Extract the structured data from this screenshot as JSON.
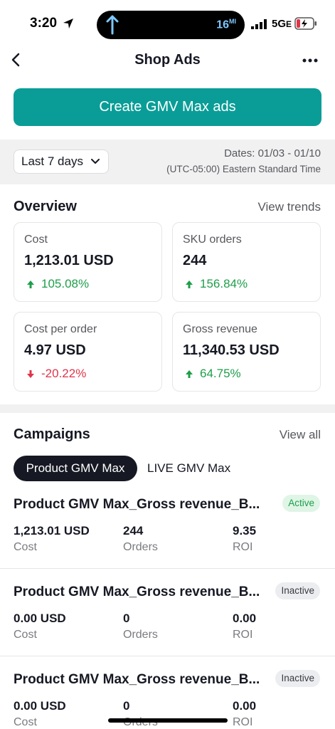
{
  "status_bar": {
    "time": "3:20",
    "speed": "16",
    "speed_unit": "MI",
    "network": "5G",
    "network_suffix": "E"
  },
  "nav": {
    "title": "Shop Ads"
  },
  "create_button": "Create GMV Max ads",
  "date_filter": {
    "range": "Last 7 days",
    "dates": "Dates: 01/03 - 01/10",
    "timezone": "(UTC-05:00) Eastern Standard Time"
  },
  "overview": {
    "title": "Overview",
    "link": "View trends",
    "cards": [
      {
        "label": "Cost",
        "value": "1,213.01 USD",
        "delta": "105.08%",
        "direction": "up"
      },
      {
        "label": "SKU orders",
        "value": "244",
        "delta": "156.84%",
        "direction": "up"
      },
      {
        "label": "Cost per order",
        "value": "4.97 USD",
        "delta": "-20.22%",
        "direction": "down"
      },
      {
        "label": "Gross revenue",
        "value": "11,340.53 USD",
        "delta": "64.75%",
        "direction": "up"
      }
    ]
  },
  "campaigns": {
    "title": "Campaigns",
    "link": "View all",
    "tabs": [
      "Product GMV Max",
      "LIVE GMV Max"
    ],
    "items": [
      {
        "name": "Product GMV Max_Gross revenue_B...",
        "status": "Active",
        "cost": "1,213.01 USD",
        "orders": "244",
        "roi": "9.35"
      },
      {
        "name": "Product GMV Max_Gross revenue_B...",
        "status": "Inactive",
        "cost": "0.00 USD",
        "orders": "0",
        "roi": "0.00"
      },
      {
        "name": "Product GMV Max_Gross revenue_B...",
        "status": "Inactive",
        "cost": "0.00 USD",
        "orders": "0",
        "roi": "0.00"
      }
    ],
    "metric_labels": {
      "cost": "Cost",
      "orders": "Orders",
      "roi": "ROI"
    }
  },
  "colors": {
    "accent": "#0a9d97",
    "positive": "#1e9e4a",
    "negative": "#e0344a"
  }
}
